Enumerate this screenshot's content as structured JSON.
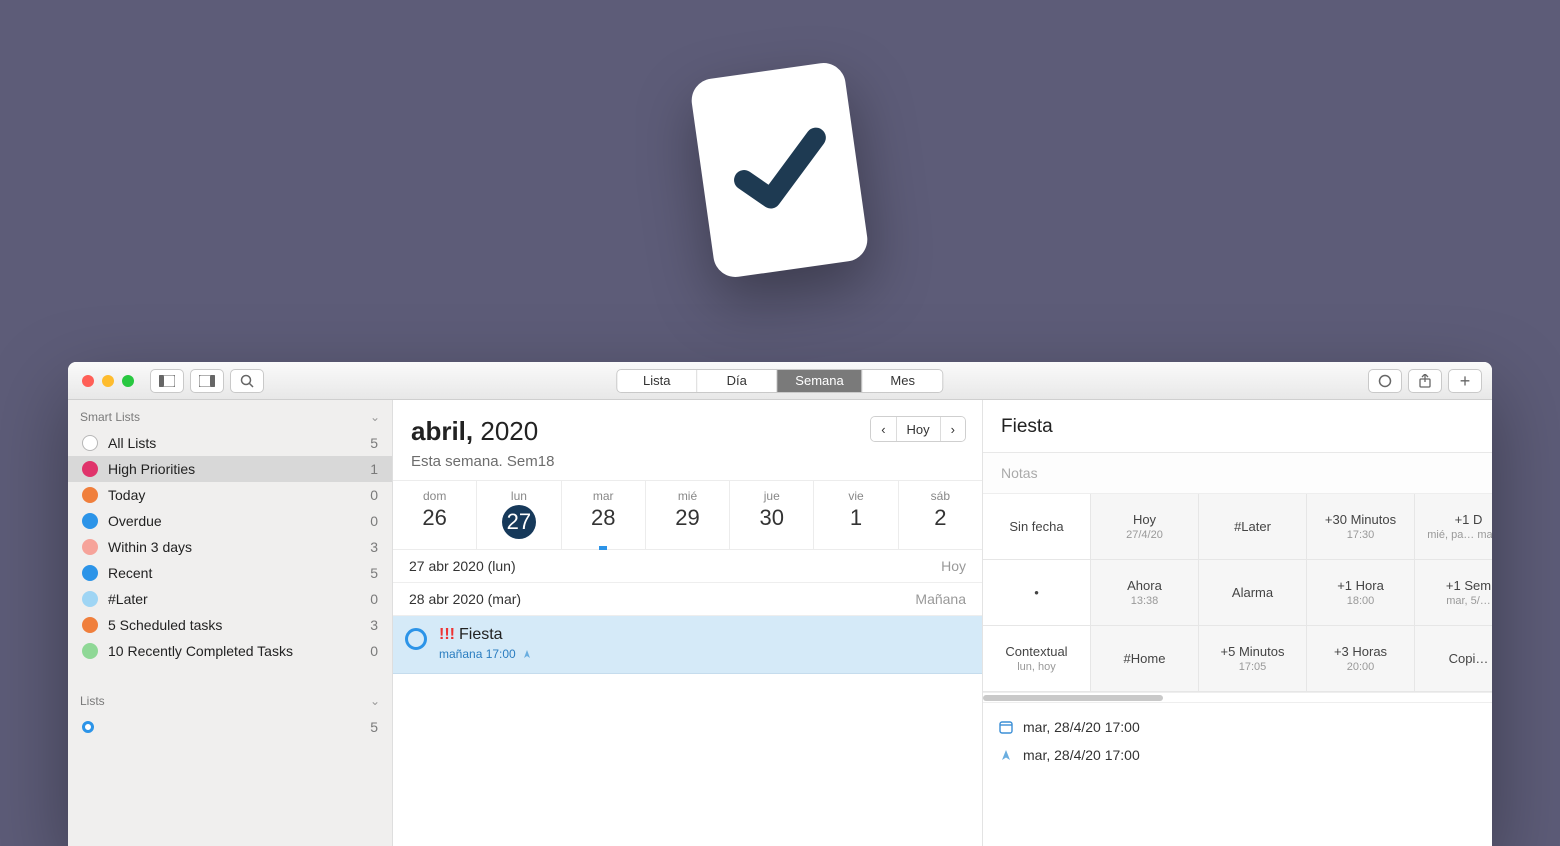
{
  "segmented": {
    "items": [
      "Lista",
      "Día",
      "Semana",
      "Mes"
    ],
    "active": "Semana"
  },
  "toolbar_right": {
    "circle": "circle",
    "share": "share",
    "add": "+"
  },
  "sidebar": {
    "section1": "Smart Lists",
    "section2": "Lists",
    "items": [
      {
        "icon": "check-icon",
        "color": "#ffffff",
        "stroke": "#b7b7b7",
        "label": "All Lists",
        "count": "5",
        "sel": false
      },
      {
        "icon": "priority-icon",
        "color": "#e0336b",
        "label": "High Priorities",
        "count": "1",
        "sel": true
      },
      {
        "icon": "clock-icon",
        "color": "#f07f3c",
        "label": "Today",
        "count": "0",
        "sel": false
      },
      {
        "icon": "overdue-icon",
        "color": "#2c94e8",
        "label": "Overdue",
        "count": "0",
        "sel": false
      },
      {
        "icon": "within-icon",
        "color": "#f6a39a",
        "label": "Within 3 days",
        "count": "3",
        "sel": false
      },
      {
        "icon": "recent-icon",
        "color": "#2c94e8",
        "label": "Recent",
        "count": "5",
        "sel": false
      },
      {
        "icon": "later-icon",
        "color": "#9fd5f4",
        "label": "#Later",
        "count": "0",
        "sel": false
      },
      {
        "icon": "sched-icon",
        "color": "#f07f3c",
        "label": "5 Scheduled tasks",
        "count": "3",
        "sel": false
      },
      {
        "icon": "done-icon",
        "color": "#8fd896",
        "label": "10 Recently Completed Tasks",
        "count": "0",
        "sel": false
      }
    ],
    "lists": [
      {
        "icon": "list-dot-icon",
        "color": "#2c94e8",
        "label": "",
        "count": "5"
      }
    ]
  },
  "week": {
    "title_bold": "abril,",
    "title_rest": " 2020",
    "subtitle": "Esta semana. Sem18",
    "nav": {
      "prev": "‹",
      "today": "Hoy",
      "next": "›"
    },
    "days": [
      {
        "name": "dom",
        "num": "26",
        "today": false,
        "mark": false
      },
      {
        "name": "lun",
        "num": "27",
        "today": true,
        "mark": false
      },
      {
        "name": "mar",
        "num": "28",
        "today": false,
        "mark": true
      },
      {
        "name": "mié",
        "num": "29",
        "today": false,
        "mark": false
      },
      {
        "name": "jue",
        "num": "30",
        "today": false,
        "mark": false
      },
      {
        "name": "vie",
        "num": "1",
        "today": false,
        "mark": false
      },
      {
        "name": "sáb",
        "num": "2",
        "today": false,
        "mark": false
      }
    ],
    "agenda": [
      {
        "left": "27 abr 2020 (lun)",
        "right": "Hoy"
      },
      {
        "left": "28 abr 2020 (mar)",
        "right": "Mañana"
      }
    ],
    "task": {
      "priority": "!!!",
      "title": "Fiesta",
      "subtitle": "mañana 17:00"
    }
  },
  "detail": {
    "title": "Fiesta",
    "notes_placeholder": "Notas",
    "chips": [
      [
        {
          "t": "Sin fecha",
          "s": "",
          "white": true
        },
        {
          "t": "Hoy",
          "s": "27/4/20"
        },
        {
          "t": "#Later",
          "s": ""
        },
        {
          "t": "+30 Minutos",
          "s": "17:30"
        },
        {
          "t": "+1 D",
          "s": "mié, pa… mañ…"
        }
      ],
      [
        {
          "t": "•",
          "s": "",
          "white": true
        },
        {
          "t": "Ahora",
          "s": "13:38"
        },
        {
          "t": "Alarma",
          "s": ""
        },
        {
          "t": "+1 Hora",
          "s": "18:00"
        },
        {
          "t": "+1 Sem",
          "s": "mar, 5/…"
        }
      ],
      [
        {
          "t": "Contextual",
          "s": "lun, hoy",
          "white": true
        },
        {
          "t": "#Home",
          "s": ""
        },
        {
          "t": "+5 Minutos",
          "s": "17:05"
        },
        {
          "t": "+3 Horas",
          "s": "20:00"
        },
        {
          "t": "Copi…",
          "s": ""
        }
      ]
    ],
    "dates": [
      {
        "icon": "calendar",
        "text": "mar, 28/4/20 17:00"
      },
      {
        "icon": "alarm",
        "text": "mar, 28/4/20 17:00"
      }
    ]
  }
}
